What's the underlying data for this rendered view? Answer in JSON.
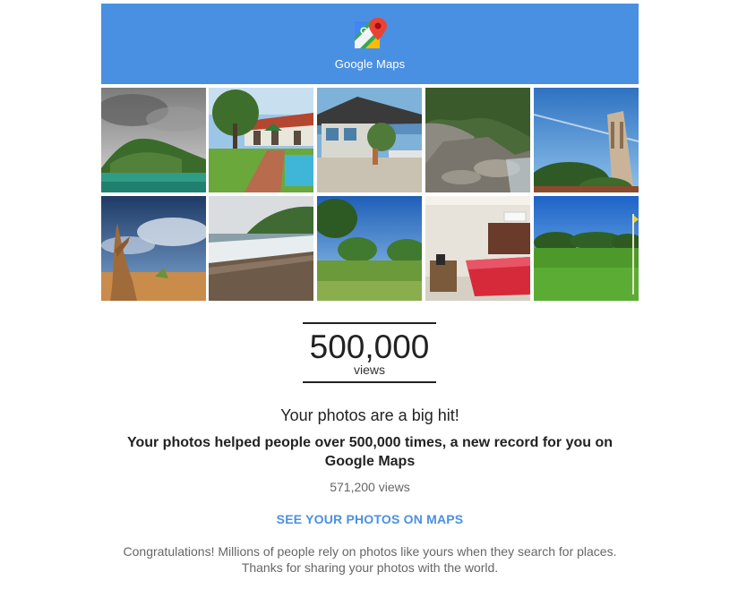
{
  "header": {
    "logo_icon": "google-maps-pin-icon",
    "brand": "Google Maps",
    "background_color": "#4a90e2"
  },
  "photos": [
    {
      "name": "cloudy-island-photo"
    },
    {
      "name": "villa-pool-photo"
    },
    {
      "name": "guesthouse-terrace-photo"
    },
    {
      "name": "rocky-stream-photo"
    },
    {
      "name": "clock-tower-photo"
    },
    {
      "name": "driftwood-sky-photo"
    },
    {
      "name": "beach-waves-photo"
    },
    {
      "name": "park-trees-photo"
    },
    {
      "name": "hotel-room-photo"
    },
    {
      "name": "golf-course-photo"
    }
  ],
  "milestone": {
    "number": "500,000",
    "unit": "views"
  },
  "message": {
    "headline": "Your photos are a big hit!",
    "subhead": "Your photos helped people over 500,000 times, a new record for you on Google Maps",
    "total_views": "571,200 views",
    "cta_label": "SEE YOUR PHOTOS ON MAPS",
    "cta_color": "#4a90e2",
    "body_line1": "Congratulations! Millions of people rely on photos like yours when they search for places.",
    "body_line2": "Thanks for sharing your photos with the world."
  }
}
